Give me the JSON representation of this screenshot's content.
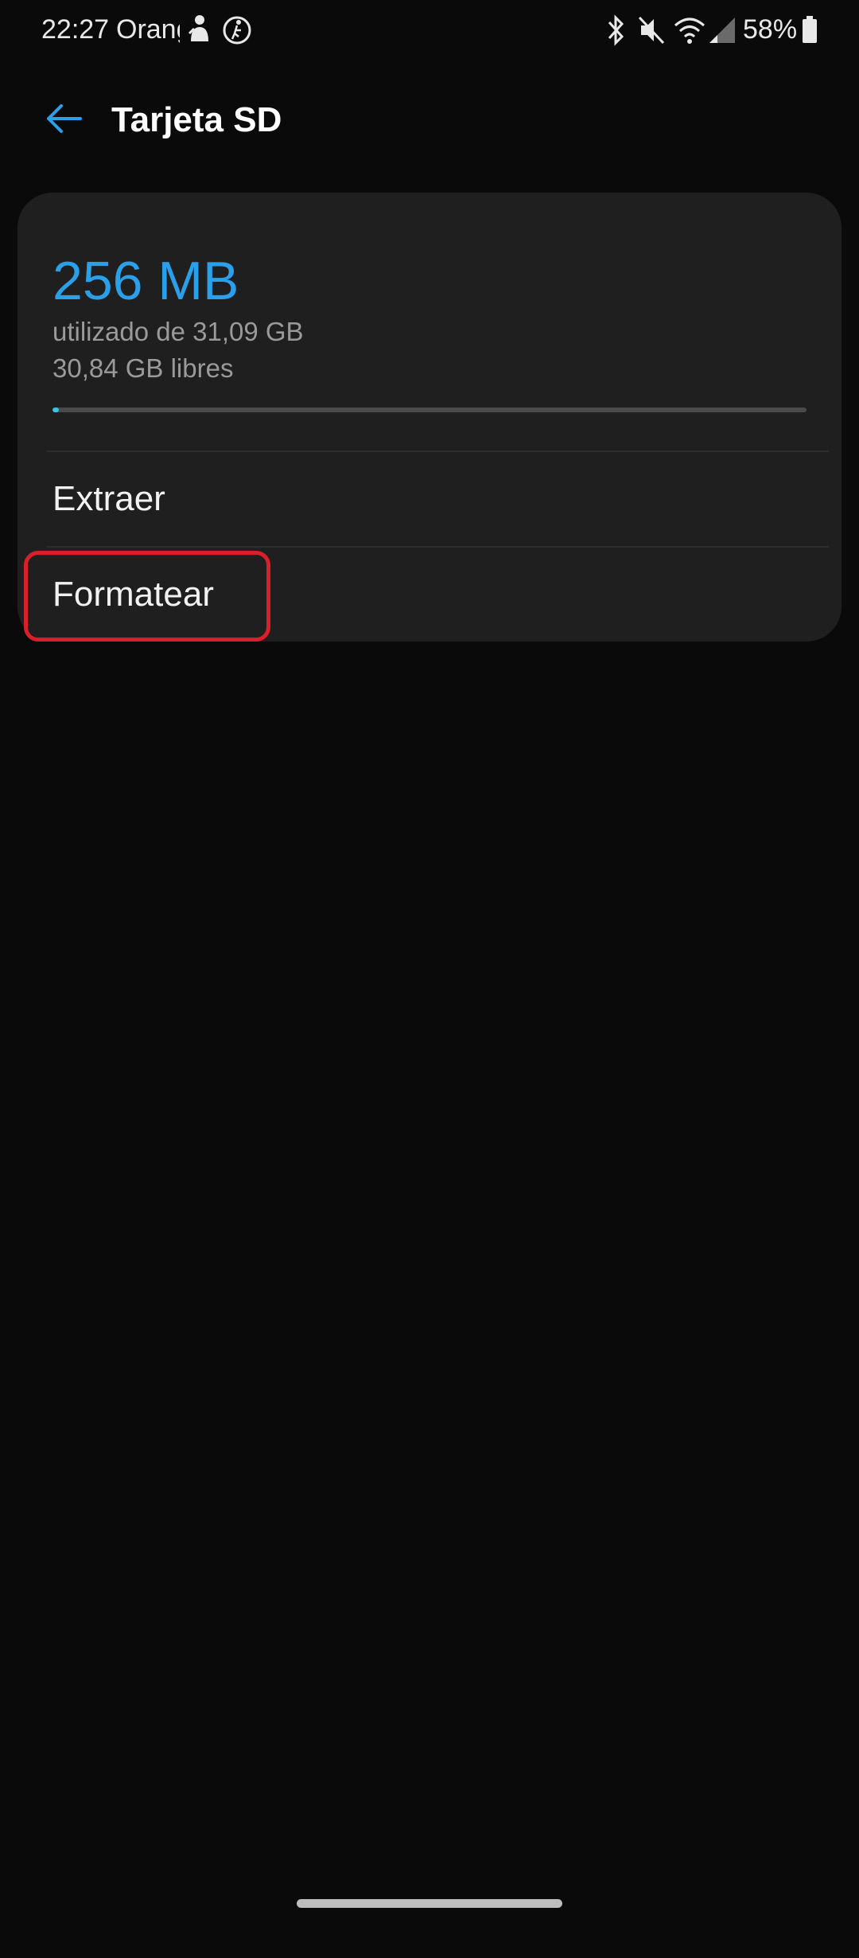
{
  "status_bar": {
    "time": "22:27",
    "carrier": "Orange",
    "battery": "58%",
    "icons": [
      "notification-icon",
      "walking-icon",
      "bluetooth-icon",
      "mute-icon",
      "wifi-icon",
      "signal-icon",
      "battery-icon"
    ]
  },
  "app_bar": {
    "title": "Tarjeta SD",
    "back_icon": "arrow-left-icon"
  },
  "storage": {
    "used": "256 MB",
    "used_of": "utilizado de 31,09 GB",
    "free": "30,84 GB libres",
    "used_fraction": 0.008
  },
  "menu": {
    "items": [
      {
        "label": "Extraer"
      },
      {
        "label": "Formatear"
      }
    ]
  },
  "colors": {
    "accent": "#2aa0ea",
    "progress": "#3ac3e0",
    "highlight": "#d9202a",
    "background": "#0a0a0a",
    "card": "#1f1f1f"
  }
}
